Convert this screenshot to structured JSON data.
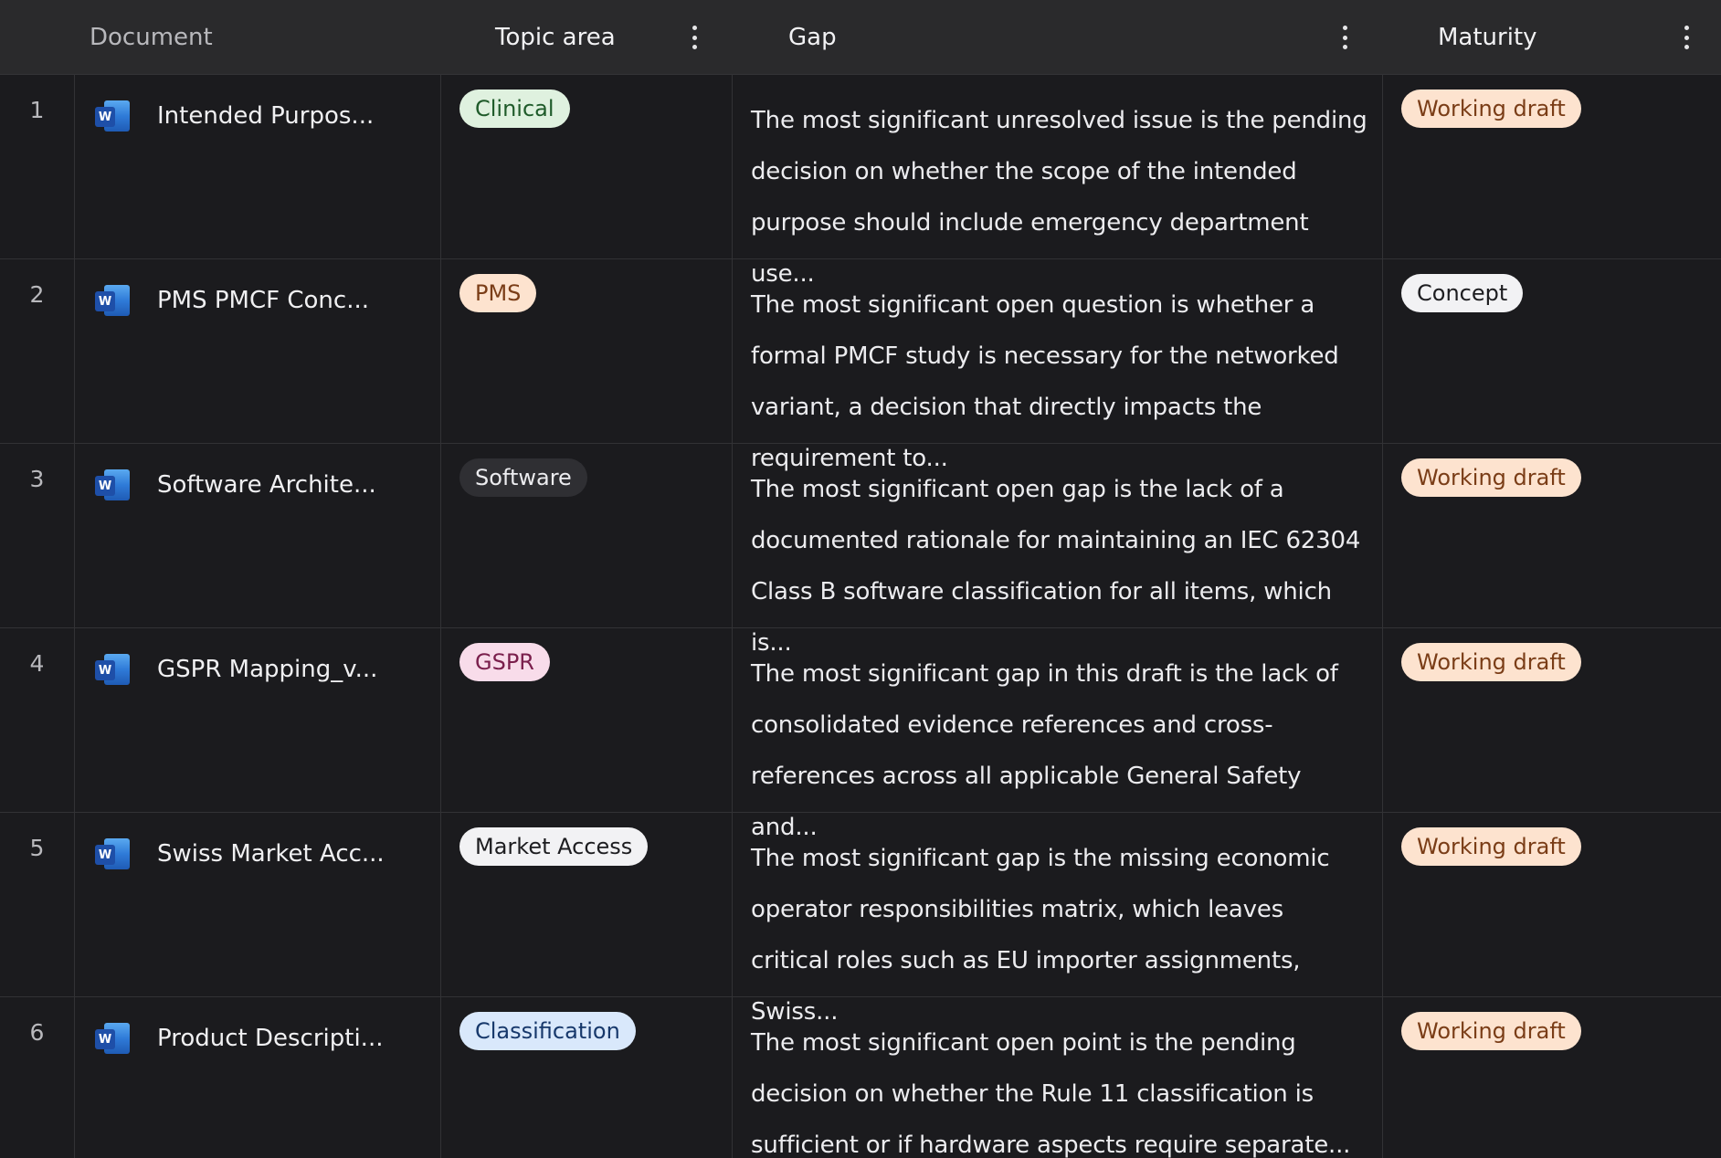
{
  "columns": {
    "document": "Document",
    "topic": "Topic area",
    "gap": "Gap",
    "maturity": "Maturity"
  },
  "icons": {
    "document_icon": "word-document-icon",
    "menu_icon": "vertical-dots-icon",
    "word_badge_letter": "W"
  },
  "colors": {
    "clinical_bg": "#dff1df",
    "clinical_fg": "#1f5b2a",
    "pms_bg": "#fde3cf",
    "pms_fg": "#7a3d17",
    "software_bg": "#2f2f33",
    "software_fg": "#ececef",
    "gspr_bg": "#f8dcea",
    "gspr_fg": "#7a1f4c",
    "market_bg": "#f2f2f4",
    "market_fg": "#1d1d20",
    "classification_bg": "#d9e8fb",
    "classification_fg": "#17386b",
    "working_bg": "#fde3cf",
    "working_fg": "#7a3d17",
    "concept_bg": "#f2f2f4",
    "concept_fg": "#1d1d20"
  },
  "rows": [
    {
      "num": "1",
      "doc": "Intended Purpos...",
      "topic": "Clinical",
      "gap": "The most significant unresolved issue is the pending decision on whether the scope of the intended purpose should include emergency department use...",
      "maturity": "Working draft"
    },
    {
      "num": "2",
      "doc": "PMS PMCF Conc...",
      "topic": "PMS",
      "gap": "The most significant open question is whether a formal PMCF study is necessary for the networked variant, a decision that directly impacts the requirement to...",
      "maturity": "Concept"
    },
    {
      "num": "3",
      "doc": "Software Archite...",
      "topic": "Software",
      "gap": "The most significant open gap is the lack of a documented rationale for maintaining an IEC 62304 Class B software classification for all items, which is...",
      "maturity": "Working draft"
    },
    {
      "num": "4",
      "doc": "GSPR Mapping_v...",
      "topic": "GSPR",
      "gap": "The most significant gap in this draft is the lack of consolidated evidence references and cross-references across all applicable General Safety and...",
      "maturity": "Working draft"
    },
    {
      "num": "5",
      "doc": "Swiss Market Acc...",
      "topic": "Market Access",
      "gap": "The most significant gap is the missing economic operator responsibilities matrix, which leaves critical roles such as EU importer assignments, Swiss...",
      "maturity": "Working draft"
    },
    {
      "num": "6",
      "doc": "Product Descripti...",
      "topic": "Classification",
      "gap": "The most significant open point is the pending decision on whether the Rule 11 classification is sufficient or if hardware aspects require separate...",
      "maturity": "Working draft"
    }
  ]
}
